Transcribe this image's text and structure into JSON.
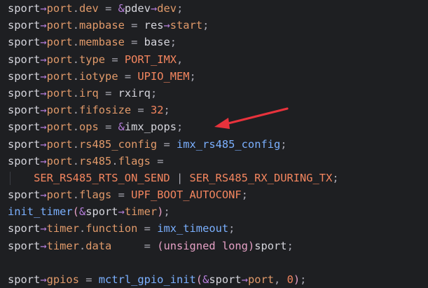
{
  "colors": {
    "background": "#1e1f22",
    "default": "#d6d6dd",
    "punct": "#a8a8b3",
    "arrow_op": "#b77fdb",
    "field": "#e19a6a",
    "macro": "#f4865f",
    "func": "#7bb0ff",
    "type": "#e5a0c5",
    "number": "#f4865f",
    "annotation": "#e8323c"
  },
  "code_lines": [
    {
      "tokens": [
        {
          "t": "sport",
          "c": "default"
        },
        {
          "t": "→",
          "c": "arrow_op"
        },
        {
          "t": "port",
          "c": "field"
        },
        {
          "t": ".",
          "c": "punct"
        },
        {
          "t": "dev",
          "c": "field"
        },
        {
          "t": " = ",
          "c": "punct"
        },
        {
          "t": "&",
          "c": "arrow_op"
        },
        {
          "t": "pdev",
          "c": "default"
        },
        {
          "t": "→",
          "c": "arrow_op"
        },
        {
          "t": "dev",
          "c": "field"
        },
        {
          "t": ";",
          "c": "punct"
        }
      ]
    },
    {
      "tokens": [
        {
          "t": "sport",
          "c": "default"
        },
        {
          "t": "→",
          "c": "arrow_op"
        },
        {
          "t": "port",
          "c": "field"
        },
        {
          "t": ".",
          "c": "punct"
        },
        {
          "t": "mapbase",
          "c": "field"
        },
        {
          "t": " = ",
          "c": "punct"
        },
        {
          "t": "res",
          "c": "default"
        },
        {
          "t": "→",
          "c": "arrow_op"
        },
        {
          "t": "start",
          "c": "field"
        },
        {
          "t": ";",
          "c": "punct"
        }
      ]
    },
    {
      "tokens": [
        {
          "t": "sport",
          "c": "default"
        },
        {
          "t": "→",
          "c": "arrow_op"
        },
        {
          "t": "port",
          "c": "field"
        },
        {
          "t": ".",
          "c": "punct"
        },
        {
          "t": "membase",
          "c": "field"
        },
        {
          "t": " = ",
          "c": "punct"
        },
        {
          "t": "base",
          "c": "default"
        },
        {
          "t": ";",
          "c": "punct"
        }
      ]
    },
    {
      "tokens": [
        {
          "t": "sport",
          "c": "default"
        },
        {
          "t": "→",
          "c": "arrow_op"
        },
        {
          "t": "port",
          "c": "field"
        },
        {
          "t": ".",
          "c": "punct"
        },
        {
          "t": "type",
          "c": "field"
        },
        {
          "t": " = ",
          "c": "punct"
        },
        {
          "t": "PORT_IMX",
          "c": "macro"
        },
        {
          "t": ",",
          "c": "punct"
        }
      ]
    },
    {
      "tokens": [
        {
          "t": "sport",
          "c": "default"
        },
        {
          "t": "→",
          "c": "arrow_op"
        },
        {
          "t": "port",
          "c": "field"
        },
        {
          "t": ".",
          "c": "punct"
        },
        {
          "t": "iotype",
          "c": "field"
        },
        {
          "t": " = ",
          "c": "punct"
        },
        {
          "t": "UPIO_MEM",
          "c": "macro"
        },
        {
          "t": ";",
          "c": "punct"
        }
      ]
    },
    {
      "tokens": [
        {
          "t": "sport",
          "c": "default"
        },
        {
          "t": "→",
          "c": "arrow_op"
        },
        {
          "t": "port",
          "c": "field"
        },
        {
          "t": ".",
          "c": "punct"
        },
        {
          "t": "irq",
          "c": "field"
        },
        {
          "t": " = ",
          "c": "punct"
        },
        {
          "t": "rxirq",
          "c": "default"
        },
        {
          "t": ";",
          "c": "punct"
        }
      ]
    },
    {
      "tokens": [
        {
          "t": "sport",
          "c": "default"
        },
        {
          "t": "→",
          "c": "arrow_op"
        },
        {
          "t": "port",
          "c": "field"
        },
        {
          "t": ".",
          "c": "punct"
        },
        {
          "t": "fifosize",
          "c": "field"
        },
        {
          "t": " = ",
          "c": "punct"
        },
        {
          "t": "32",
          "c": "number"
        },
        {
          "t": ";",
          "c": "punct"
        }
      ]
    },
    {
      "tokens": [
        {
          "t": "sport",
          "c": "default"
        },
        {
          "t": "→",
          "c": "arrow_op"
        },
        {
          "t": "port",
          "c": "field"
        },
        {
          "t": ".",
          "c": "punct"
        },
        {
          "t": "ops",
          "c": "field"
        },
        {
          "t": " = ",
          "c": "punct"
        },
        {
          "t": "&",
          "c": "arrow_op"
        },
        {
          "t": "imx_pops",
          "c": "default"
        },
        {
          "t": ";",
          "c": "punct"
        }
      ]
    },
    {
      "tokens": [
        {
          "t": "sport",
          "c": "default"
        },
        {
          "t": "→",
          "c": "arrow_op"
        },
        {
          "t": "port",
          "c": "field"
        },
        {
          "t": ".",
          "c": "punct"
        },
        {
          "t": "rs485_config",
          "c": "field"
        },
        {
          "t": " = ",
          "c": "punct"
        },
        {
          "t": "imx_rs485_config",
          "c": "func"
        },
        {
          "t": ";",
          "c": "punct"
        }
      ]
    },
    {
      "tokens": [
        {
          "t": "sport",
          "c": "default"
        },
        {
          "t": "→",
          "c": "arrow_op"
        },
        {
          "t": "port",
          "c": "field"
        },
        {
          "t": ".",
          "c": "punct"
        },
        {
          "t": "rs485",
          "c": "field"
        },
        {
          "t": ".",
          "c": "punct"
        },
        {
          "t": "flags",
          "c": "field"
        },
        {
          "t": " =",
          "c": "punct"
        }
      ]
    },
    {
      "guide": true,
      "tokens": [
        {
          "t": "    ",
          "c": "default"
        },
        {
          "t": "SER_RS485_RTS_ON_SEND",
          "c": "macro"
        },
        {
          "t": " | ",
          "c": "punct"
        },
        {
          "t": "SER_RS485_RX_DURING_TX",
          "c": "macro"
        },
        {
          "t": ";",
          "c": "punct"
        }
      ]
    },
    {
      "tokens": [
        {
          "t": "sport",
          "c": "default"
        },
        {
          "t": "→",
          "c": "arrow_op"
        },
        {
          "t": "port",
          "c": "field"
        },
        {
          "t": ".",
          "c": "punct"
        },
        {
          "t": "flags",
          "c": "field"
        },
        {
          "t": " = ",
          "c": "punct"
        },
        {
          "t": "UPF_BOOT_AUTOCONF",
          "c": "macro"
        },
        {
          "t": ";",
          "c": "punct"
        }
      ]
    },
    {
      "tokens": [
        {
          "t": "init_timer",
          "c": "func"
        },
        {
          "t": "(",
          "c": "type"
        },
        {
          "t": "&",
          "c": "arrow_op"
        },
        {
          "t": "sport",
          "c": "default"
        },
        {
          "t": "→",
          "c": "arrow_op"
        },
        {
          "t": "timer",
          "c": "field"
        },
        {
          "t": ")",
          "c": "type"
        },
        {
          "t": ";",
          "c": "punct"
        }
      ]
    },
    {
      "tokens": [
        {
          "t": "sport",
          "c": "default"
        },
        {
          "t": "→",
          "c": "arrow_op"
        },
        {
          "t": "timer",
          "c": "field"
        },
        {
          "t": ".",
          "c": "punct"
        },
        {
          "t": "function",
          "c": "field"
        },
        {
          "t": " = ",
          "c": "punct"
        },
        {
          "t": "imx_timeout",
          "c": "func"
        },
        {
          "t": ";",
          "c": "punct"
        }
      ]
    },
    {
      "tokens": [
        {
          "t": "sport",
          "c": "default"
        },
        {
          "t": "→",
          "c": "arrow_op"
        },
        {
          "t": "timer",
          "c": "field"
        },
        {
          "t": ".",
          "c": "punct"
        },
        {
          "t": "data",
          "c": "field"
        },
        {
          "t": "     = ",
          "c": "punct"
        },
        {
          "t": "(",
          "c": "type"
        },
        {
          "t": "unsigned long",
          "c": "type"
        },
        {
          "t": ")",
          "c": "type"
        },
        {
          "t": "sport",
          "c": "default"
        },
        {
          "t": ";",
          "c": "punct"
        }
      ]
    },
    {
      "tokens": []
    },
    {
      "tokens": [
        {
          "t": "sport",
          "c": "default"
        },
        {
          "t": "→",
          "c": "arrow_op"
        },
        {
          "t": "gpios",
          "c": "field"
        },
        {
          "t": " = ",
          "c": "punct"
        },
        {
          "t": "mctrl_gpio_init",
          "c": "func"
        },
        {
          "t": "(",
          "c": "type"
        },
        {
          "t": "&",
          "c": "arrow_op"
        },
        {
          "t": "sport",
          "c": "default"
        },
        {
          "t": "→",
          "c": "arrow_op"
        },
        {
          "t": "port",
          "c": "field"
        },
        {
          "t": ", ",
          "c": "punct"
        },
        {
          "t": "0",
          "c": "number"
        },
        {
          "t": ")",
          "c": "type"
        },
        {
          "t": ";",
          "c": "punct"
        }
      ]
    }
  ],
  "annotation": {
    "icon": "red-arrow-icon",
    "target_line": 7
  }
}
